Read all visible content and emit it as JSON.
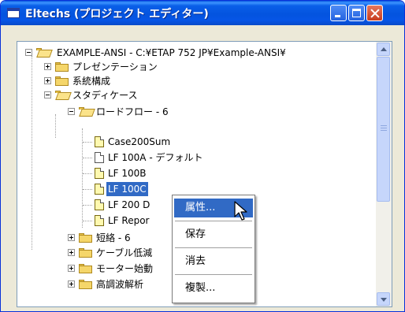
{
  "window": {
    "title": "Eltechs (プロジェクト エディター)",
    "title_icon": "window-app-icon",
    "buttons": [
      "minimize",
      "maximize",
      "close"
    ]
  },
  "tree": {
    "root": "EXAMPLE-ANSI - C:¥ETAP 752 JP¥Example-ANSI¥",
    "presentations": "プレゼンテーション",
    "system_config": "系統構成",
    "study_case": "スタディケース",
    "load_flow": "ロードフロー - 6",
    "lf_items": [
      "Case200Sum",
      "LF 100A - デフォルト",
      "LF 100B",
      "LF 100C",
      "LF 200 D",
      "LF Repor"
    ],
    "short_circuit": "短絡 - 6",
    "cable_derating": "ケーブル低減",
    "motor_starting": "モーター始動",
    "harmonic": "高調波解析"
  },
  "context_menu": {
    "items": [
      "属性...",
      "保存",
      "消去",
      "複製..."
    ],
    "highlighted": "属性..."
  },
  "colors": {
    "titlebar": "#0454df",
    "selection": "#316ac5",
    "window_bg": "#ece9d8"
  }
}
